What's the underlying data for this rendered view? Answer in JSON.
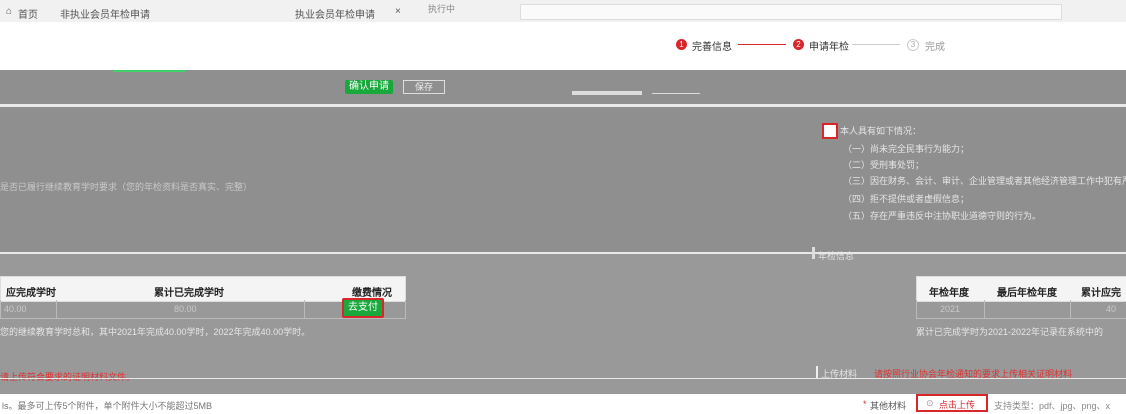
{
  "tabs": [
    {
      "label": "首页"
    },
    {
      "label": "非执业会员年检申请"
    },
    {
      "label": "执业会员年检申请"
    }
  ],
  "status_pill": "执行中",
  "steps": [
    {
      "num": "1",
      "label": "完善信息",
      "state": "done"
    },
    {
      "num": "2",
      "label": "申请年检",
      "state": "active"
    },
    {
      "num": "3",
      "label": "完成",
      "state": "pending"
    }
  ],
  "confirm_button": "确认申请",
  "save_button": "保存",
  "left_question": "是否已履行继续教育学时要求（您的年检资料是否真实、完整）",
  "right_section": {
    "heading": "本人具有如下情况：",
    "items": [
      "（一）尚未完全民事行为能力；",
      "（二）受刑事处罚；",
      "（三）因在财务、会计、审计、企业管理或者其他经济管理工作中犯有严重错误",
      "（四）拒不提供或者虚假信息；",
      "（五）存在严重违反中注协职业道德守则的行为。"
    ]
  },
  "annual_info_title": "年检信息",
  "left_table": {
    "headers": [
      "应完成学时",
      "累计已完成学时",
      "缴费情况"
    ],
    "row": [
      "40.00",
      "80.00",
      "去支付"
    ],
    "note": "您的继续教育学时总和，其中2021年完成40.00学时，2022年完成40.00学时。"
  },
  "right_table": {
    "headers": [
      "年检年度",
      "最后年检年度",
      "累计应完"
    ],
    "row": [
      "2021",
      "",
      "40"
    ],
    "note": "累计已完成学时为2021-2022年记录在系统中的"
  },
  "left_upload_tip": "请上传符合要求的证明材料文件。",
  "upload_section": {
    "title": "上传材料",
    "tip": "请按照行业协会年检通知的要求上传相关证明材料"
  },
  "footer_left": "ls。最多可上传5个附件，单个附件大小不能超过5MB",
  "footer_right": {
    "required_mark": "*",
    "label": "其他材料",
    "upload_button": "点击上传",
    "support": "支持类型：pdf、jpg、png、x"
  },
  "colors": {
    "accent_red": "#d9262a",
    "green": "#19a83c",
    "overlay_gray": "#8f8f8f"
  }
}
